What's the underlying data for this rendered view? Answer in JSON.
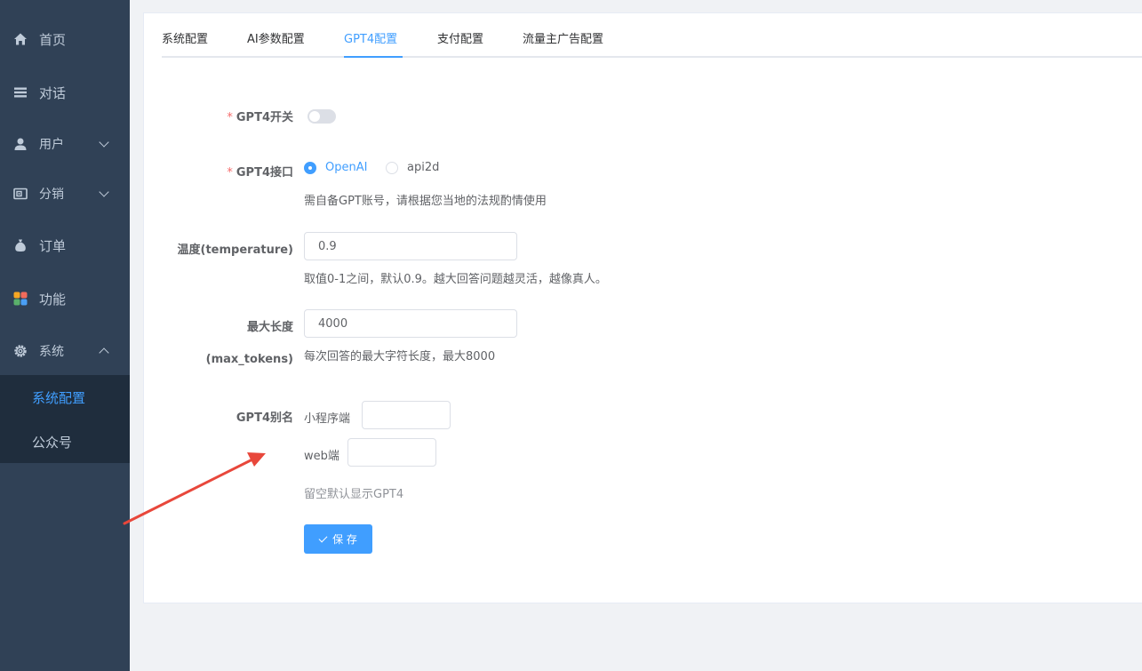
{
  "sidebar": {
    "items": [
      {
        "label": "首页",
        "icon": "home-icon"
      },
      {
        "label": "对话",
        "icon": "list-icon"
      },
      {
        "label": "用户",
        "icon": "user-icon"
      },
      {
        "label": "分销",
        "icon": "wallet-icon"
      },
      {
        "label": "订单",
        "icon": "money-bag-icon"
      },
      {
        "label": "功能",
        "icon": "apps-icon"
      },
      {
        "label": "系统",
        "icon": "gear-icon"
      }
    ],
    "submenu": [
      {
        "label": "系统配置",
        "active": true
      },
      {
        "label": "公众号",
        "active": false
      }
    ]
  },
  "tabs": [
    {
      "label": "系统配置"
    },
    {
      "label": "AI参数配置"
    },
    {
      "label": "GPT4配置",
      "active": true
    },
    {
      "label": "支付配置"
    },
    {
      "label": "流量主广告配置"
    }
  ],
  "form": {
    "switch_label": "GPT4开关",
    "switch_on": false,
    "interface_label": "GPT4接口",
    "interface_options": [
      "OpenAI",
      "api2d"
    ],
    "interface_selected": "OpenAI",
    "interface_hint": "需自备GPT账号，请根据您当地的法规酌情使用",
    "temperature_label": "温度(temperature)",
    "temperature_value": "0.9",
    "temperature_hint": "取值0-1之间，默认0.9。越大回答问题越灵活，越像真人。",
    "max_tokens_label_line1": "最大长度",
    "max_tokens_label_line2": "(max_tokens)",
    "max_tokens_value": "4000",
    "max_tokens_hint": "每次回答的最大字符长度，最大8000",
    "alias_label": "GPT4别名",
    "alias_mini_label": "小程序端",
    "alias_mini_value": "",
    "alias_web_label": "web端",
    "alias_web_value": "",
    "alias_hint": "留空默认显示GPT4",
    "save_label": "保 存"
  },
  "colors": {
    "sidebar_bg": "#304156",
    "submenu_bg": "#1f2d3d",
    "accent": "#409eff",
    "required": "#f56c6c",
    "annotation_arrow": "#e8473b"
  }
}
